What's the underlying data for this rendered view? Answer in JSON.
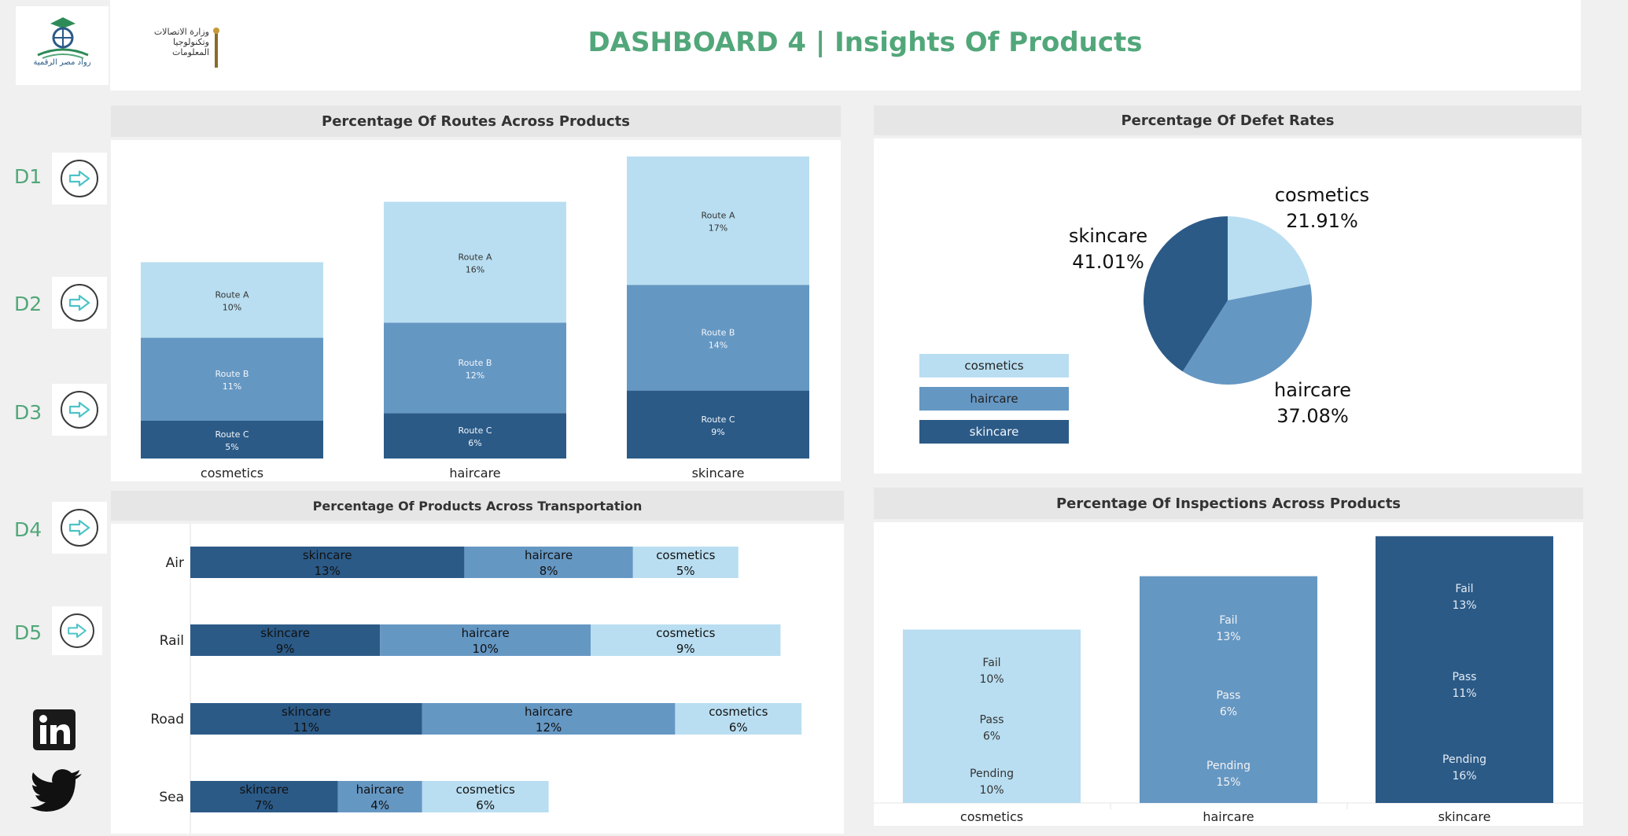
{
  "header": {
    "title": "DASHBOARD 4 | Insights Of Products",
    "logo1_text": "رواد مصر الرقمية",
    "logo2_line1": "وزارة الاتصالات",
    "logo2_line2": "وتكنولوجيا المعلومات"
  },
  "colors": {
    "light": "#b9def1",
    "mid": "#6597c3",
    "dark": "#2b5a87",
    "title": "#52a77a"
  },
  "nav": {
    "items": [
      {
        "label": "D1",
        "icon": "arrow-right-icon"
      },
      {
        "label": "D2",
        "icon": "arrow-right-icon"
      },
      {
        "label": "D3",
        "icon": "arrow-right-icon"
      },
      {
        "label": "D4",
        "icon": "arrow-right-icon"
      },
      {
        "label": "D5",
        "icon": "arrow-right-icon"
      }
    ],
    "social": [
      "linkedin-icon",
      "twitter-icon"
    ]
  },
  "routes_chart": {
    "title": "Percentage Of Routes  Across Products",
    "categories": [
      "cosmetics",
      "haircare",
      "skincare"
    ],
    "segments": [
      {
        "name": "Route C",
        "values": [
          5,
          6,
          9
        ],
        "labels": [
          "5%",
          "6%",
          "9%"
        ]
      },
      {
        "name": "Route B",
        "values": [
          11,
          12,
          14
        ],
        "labels": [
          "11%",
          "12%",
          "14%"
        ]
      },
      {
        "name": "Route A",
        "values": [
          10,
          16,
          17
        ],
        "labels": [
          "10%",
          "16%",
          "17%"
        ]
      }
    ]
  },
  "defect_chart": {
    "title": "Percentage Of Defet Rates",
    "slices": [
      {
        "name": "cosmetics",
        "value": 21.91,
        "label": "21.91%"
      },
      {
        "name": "haircare",
        "value": 37.08,
        "label": "37.08%"
      },
      {
        "name": "skincare",
        "value": 41.01,
        "label": "41.01%"
      }
    ],
    "legend": [
      "cosmetics",
      "haircare",
      "skincare"
    ]
  },
  "transport_chart": {
    "title": "Percentage Of Products Across Transportation",
    "modes": [
      "Air",
      "Rail",
      "Road",
      "Sea"
    ],
    "products": [
      "skincare",
      "haircare",
      "cosmetics"
    ],
    "values": [
      [
        13,
        8,
        5
      ],
      [
        9,
        10,
        9
      ],
      [
        11,
        12,
        6
      ],
      [
        7,
        4,
        6
      ]
    ],
    "labels": [
      [
        "13%",
        "8%",
        "5%"
      ],
      [
        "9%",
        "10%",
        "9%"
      ],
      [
        "11%",
        "12%",
        "6%"
      ],
      [
        "7%",
        "4%",
        "6%"
      ]
    ]
  },
  "inspection_chart": {
    "title": "Percentage Of Inspections Across Products",
    "categories": [
      "cosmetics",
      "haircare",
      "skincare"
    ],
    "results": [
      "Fail",
      "Pass",
      "Pending"
    ],
    "labels": [
      [
        "10%",
        "6%",
        "10%"
      ],
      [
        "13%",
        "6%",
        "15%"
      ],
      [
        "13%",
        "11%",
        "16%"
      ]
    ],
    "totals": [
      26,
      34,
      40
    ]
  },
  "chart_data": [
    {
      "type": "bar",
      "title": "Percentage Of Routes  Across Products",
      "categories": [
        "cosmetics",
        "haircare",
        "skincare"
      ],
      "stacked": true,
      "series": [
        {
          "name": "Route C",
          "values": [
            5,
            6,
            9
          ]
        },
        {
          "name": "Route B",
          "values": [
            11,
            12,
            14
          ]
        },
        {
          "name": "Route A",
          "values": [
            10,
            16,
            17
          ]
        }
      ]
    },
    {
      "type": "pie",
      "title": "Percentage Of Defet Rates",
      "categories": [
        "cosmetics",
        "haircare",
        "skincare"
      ],
      "values": [
        21.91,
        37.08,
        41.01
      ]
    },
    {
      "type": "bar",
      "orientation": "horizontal",
      "stacked": true,
      "title": "Percentage Of Products Across Transportation",
      "categories": [
        "Air",
        "Rail",
        "Road",
        "Sea"
      ],
      "series": [
        {
          "name": "skincare",
          "values": [
            13,
            9,
            11,
            7
          ]
        },
        {
          "name": "haircare",
          "values": [
            8,
            10,
            12,
            4
          ]
        },
        {
          "name": "cosmetics",
          "values": [
            5,
            9,
            6,
            6
          ]
        }
      ]
    },
    {
      "type": "bar",
      "title": "Percentage Of Inspections Across Products",
      "categories": [
        "cosmetics",
        "haircare",
        "skincare"
      ],
      "series": [
        {
          "name": "Fail",
          "values": [
            10,
            13,
            13
          ]
        },
        {
          "name": "Pass",
          "values": [
            6,
            6,
            11
          ]
        },
        {
          "name": "Pending",
          "values": [
            10,
            15,
            16
          ]
        }
      ]
    }
  ]
}
